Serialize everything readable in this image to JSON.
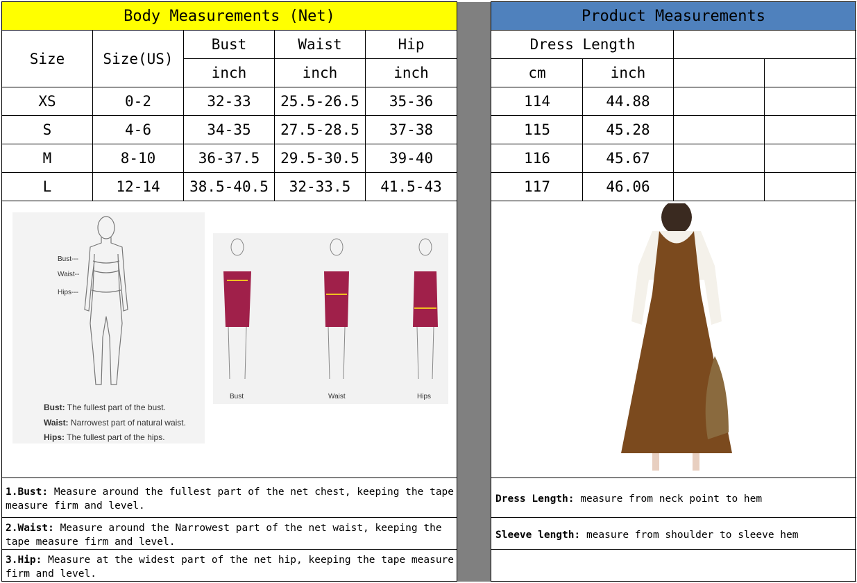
{
  "body_table": {
    "title": "Body Measurements (Net)",
    "headers": {
      "size": "Size",
      "size_us": "Size(US)",
      "bust": "Bust",
      "waist": "Waist",
      "hip": "Hip",
      "bust_unit": "inch",
      "waist_unit": "inch",
      "hip_unit": "inch"
    },
    "rows": [
      {
        "size": "XS",
        "size_us": "0-2",
        "bust": "32-33",
        "waist": "25.5-26.5",
        "hip": "35-36"
      },
      {
        "size": "S",
        "size_us": "4-6",
        "bust": "34-35",
        "waist": "27.5-28.5",
        "hip": "37-38"
      },
      {
        "size": "M",
        "size_us": "8-10",
        "bust": "36-37.5",
        "waist": "29.5-30.5",
        "hip": "39-40"
      },
      {
        "size": "L",
        "size_us": "12-14",
        "bust": "38.5-40.5",
        "waist": "32-33.5",
        "hip": "41.5-43"
      }
    ]
  },
  "product_table": {
    "title": "Product Measurements",
    "headers": {
      "dress_length": "Dress Length",
      "cm": "cm",
      "inch": "inch"
    },
    "rows": [
      {
        "cm": "114",
        "inch": "44.88"
      },
      {
        "cm": "115",
        "inch": "45.28"
      },
      {
        "cm": "116",
        "inch": "45.67"
      },
      {
        "cm": "117",
        "inch": "46.06"
      }
    ]
  },
  "guide": {
    "figure_labels": {
      "bust": "Bust---",
      "waist": "Waist--",
      "hips": "Hips---"
    },
    "legend": [
      {
        "term": "Bust:",
        "text": "The fullest part of the bust."
      },
      {
        "term": "Waist:",
        "text": "Narrowest part of natural waist."
      },
      {
        "term": "Hips:",
        "text": "The fullest part of the hips."
      }
    ],
    "mannequin_labels": [
      "Bust",
      "Waist",
      "Hips"
    ]
  },
  "notes_left": [
    {
      "term": "1.Bust:",
      "text": " Measure around the fullest part of the net chest, keeping the tape  measure firm and level."
    },
    {
      "term": "2.Waist:",
      "text": " Measure around the Narrowest part of the net waist, keeping the tape  measure firm and level."
    },
    {
      "term": "3.Hip:",
      "text": " Measure at the widest part of the net hip, keeping the tape measure firm and level."
    }
  ],
  "notes_right": [
    {
      "term": "Dress Length:",
      "text": " measure from neck point to hem"
    },
    {
      "term": "Sleeve length:",
      "text": " measure from shoulder to sleeve hem"
    }
  ],
  "colors": {
    "yellow": "#ffff00",
    "blue": "#4f81bd",
    "gray": "#808080",
    "dress": "#7b4a1e",
    "mannequin_dress": "#a0204a",
    "tape": "#f0c020"
  }
}
